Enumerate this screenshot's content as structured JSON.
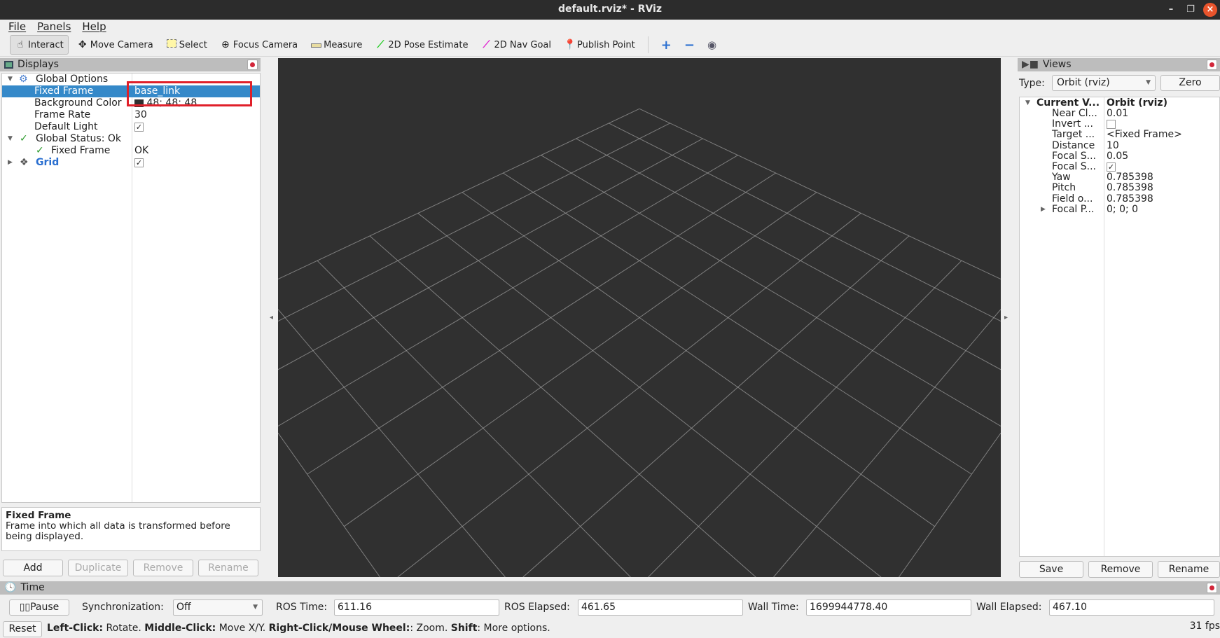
{
  "window": {
    "title": "default.rviz* - RViz"
  },
  "menu": [
    "File",
    "Panels",
    "Help"
  ],
  "toolbar": {
    "tools": [
      {
        "label": "Interact",
        "icon": "hand-icon",
        "active": true
      },
      {
        "label": "Move Camera",
        "icon": "move-camera-icon"
      },
      {
        "label": "Select",
        "icon": "select-icon"
      },
      {
        "label": "Focus Camera",
        "icon": "focus-camera-icon"
      },
      {
        "label": "Measure",
        "icon": "ruler-icon"
      },
      {
        "label": "2D Pose Estimate",
        "icon": "pose-arrow-icon",
        "color": "#22cc22"
      },
      {
        "label": "2D Nav Goal",
        "icon": "nav-goal-arrow-icon",
        "color": "#e020d0"
      },
      {
        "label": "Publish Point",
        "icon": "map-pin-icon",
        "color": "#c8502a"
      }
    ]
  },
  "displays": {
    "title": "Displays",
    "rows": [
      {
        "label": "Global Options",
        "value": "",
        "icon": "gear-icon",
        "expanded": true
      },
      {
        "label": "Fixed Frame",
        "value": "base_link",
        "selected": true
      },
      {
        "label": "Background Color",
        "value": "48; 48; 48",
        "swatch": "#303030"
      },
      {
        "label": "Frame Rate",
        "value": "30"
      },
      {
        "label": "Default Light",
        "checked": true
      },
      {
        "label": "Global Status: Ok",
        "icon": "check-icon",
        "expanded": true
      },
      {
        "label": "Fixed Frame",
        "value": "OK",
        "icon": "check-icon"
      },
      {
        "label": "Grid",
        "checked": true,
        "icon": "grid-icon",
        "expanded": false
      }
    ],
    "help_title": "Fixed Frame",
    "help_text": "Frame into which all data is transformed before being displayed.",
    "buttons": [
      "Add",
      "Duplicate",
      "Remove",
      "Rename"
    ],
    "highlight_color": "#e0202a"
  },
  "views": {
    "title": "Views",
    "type_label": "Type:",
    "type_value": "Orbit (rviz)",
    "zero_label": "Zero",
    "header": {
      "label": "Current V...",
      "value": "Orbit (rviz)"
    },
    "rows": [
      {
        "label": "Near Cl...",
        "value": "0.01"
      },
      {
        "label": "Invert ...",
        "checked": false
      },
      {
        "label": "Target ...",
        "value": "<Fixed Frame>"
      },
      {
        "label": "Distance",
        "value": "10"
      },
      {
        "label": "Focal S...",
        "value": "0.05"
      },
      {
        "label": "Focal S...",
        "checked": true
      },
      {
        "label": "Yaw",
        "value": "0.785398"
      },
      {
        "label": "Pitch",
        "value": "0.785398"
      },
      {
        "label": "Field o...",
        "value": "0.785398"
      },
      {
        "label": "Focal P...",
        "value": "0; 0; 0",
        "collapsed": true
      }
    ],
    "buttons": [
      "Save",
      "Remove",
      "Rename"
    ]
  },
  "time": {
    "title": "Time",
    "pause_label": "Pause",
    "sync_label": "Synchronization:",
    "sync_value": "Off",
    "ros_time_label": "ROS Time:",
    "ros_time": "611.16",
    "ros_elapsed_label": "ROS Elapsed:",
    "ros_elapsed": "461.65",
    "wall_time_label": "Wall Time:",
    "wall_time": "1699944778.40",
    "wall_elapsed_label": "Wall Elapsed:",
    "wall_elapsed": "467.10"
  },
  "status": {
    "reset_label": "Reset",
    "hints": [
      {
        "b": "Left-Click:",
        "t": " Rotate. "
      },
      {
        "b": "Middle-Click:",
        "t": " Move X/Y. "
      },
      {
        "b": "Right-Click/Mouse Wheel:",
        "t": ": Zoom. "
      },
      {
        "b": "Shift",
        "t": ": More options."
      }
    ],
    "fps": "31 fps"
  },
  "scene": {
    "background": "#303030",
    "grid_color": "#a0a0a0"
  }
}
